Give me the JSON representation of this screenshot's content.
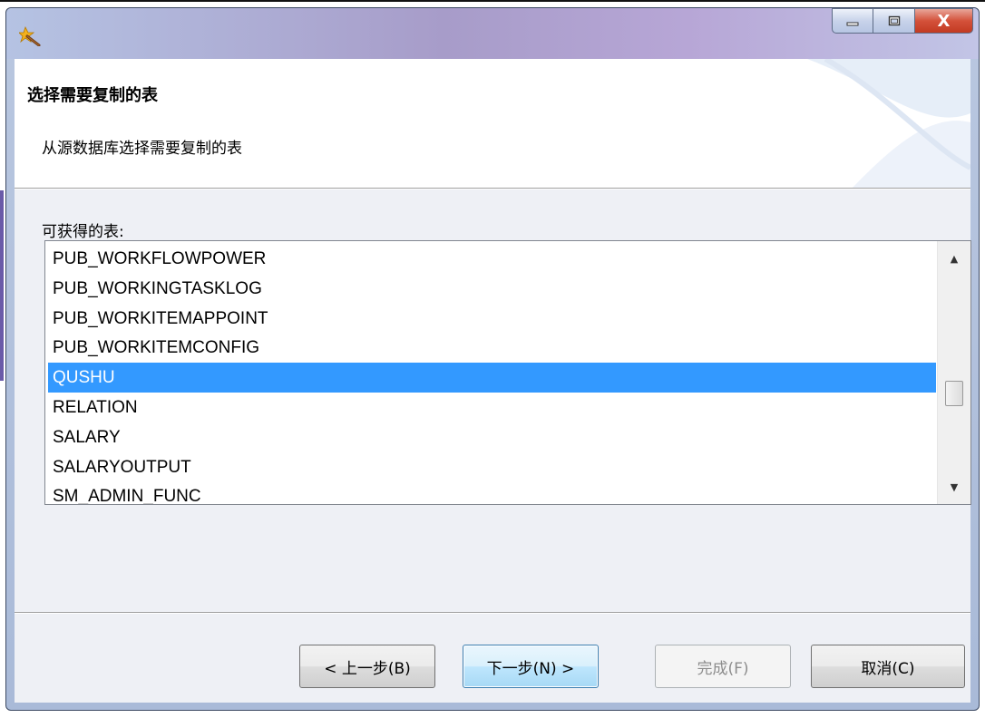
{
  "window": {
    "controls": {
      "minimize": "—",
      "maximize": "▢",
      "close": "X"
    }
  },
  "header": {
    "title": "选择需要复制的表",
    "description": "从源数据库选择需要复制的表"
  },
  "tables": {
    "label": "可获得的表:",
    "items": [
      "PUB_WORKFLOWPOWER",
      "PUB_WORKINGTASKLOG",
      "PUB_WORKITEMAPPOINT",
      "PUB_WORKITEMCONFIG",
      "QUSHU",
      "RELATION",
      "SALARY",
      "SALARYOUTPUT",
      "SM_ADMIN_FUNC"
    ],
    "selected": "QUSHU",
    "scroll_position": 0.62
  },
  "buttons": {
    "back": "< 上一步(B)",
    "next": "下一步(N) >",
    "finish": "完成(F)",
    "cancel": "取消(C)"
  },
  "colors": {
    "selection": "#3399ff",
    "titlebar": "#a79cc9",
    "close_button": "#c23a22"
  }
}
